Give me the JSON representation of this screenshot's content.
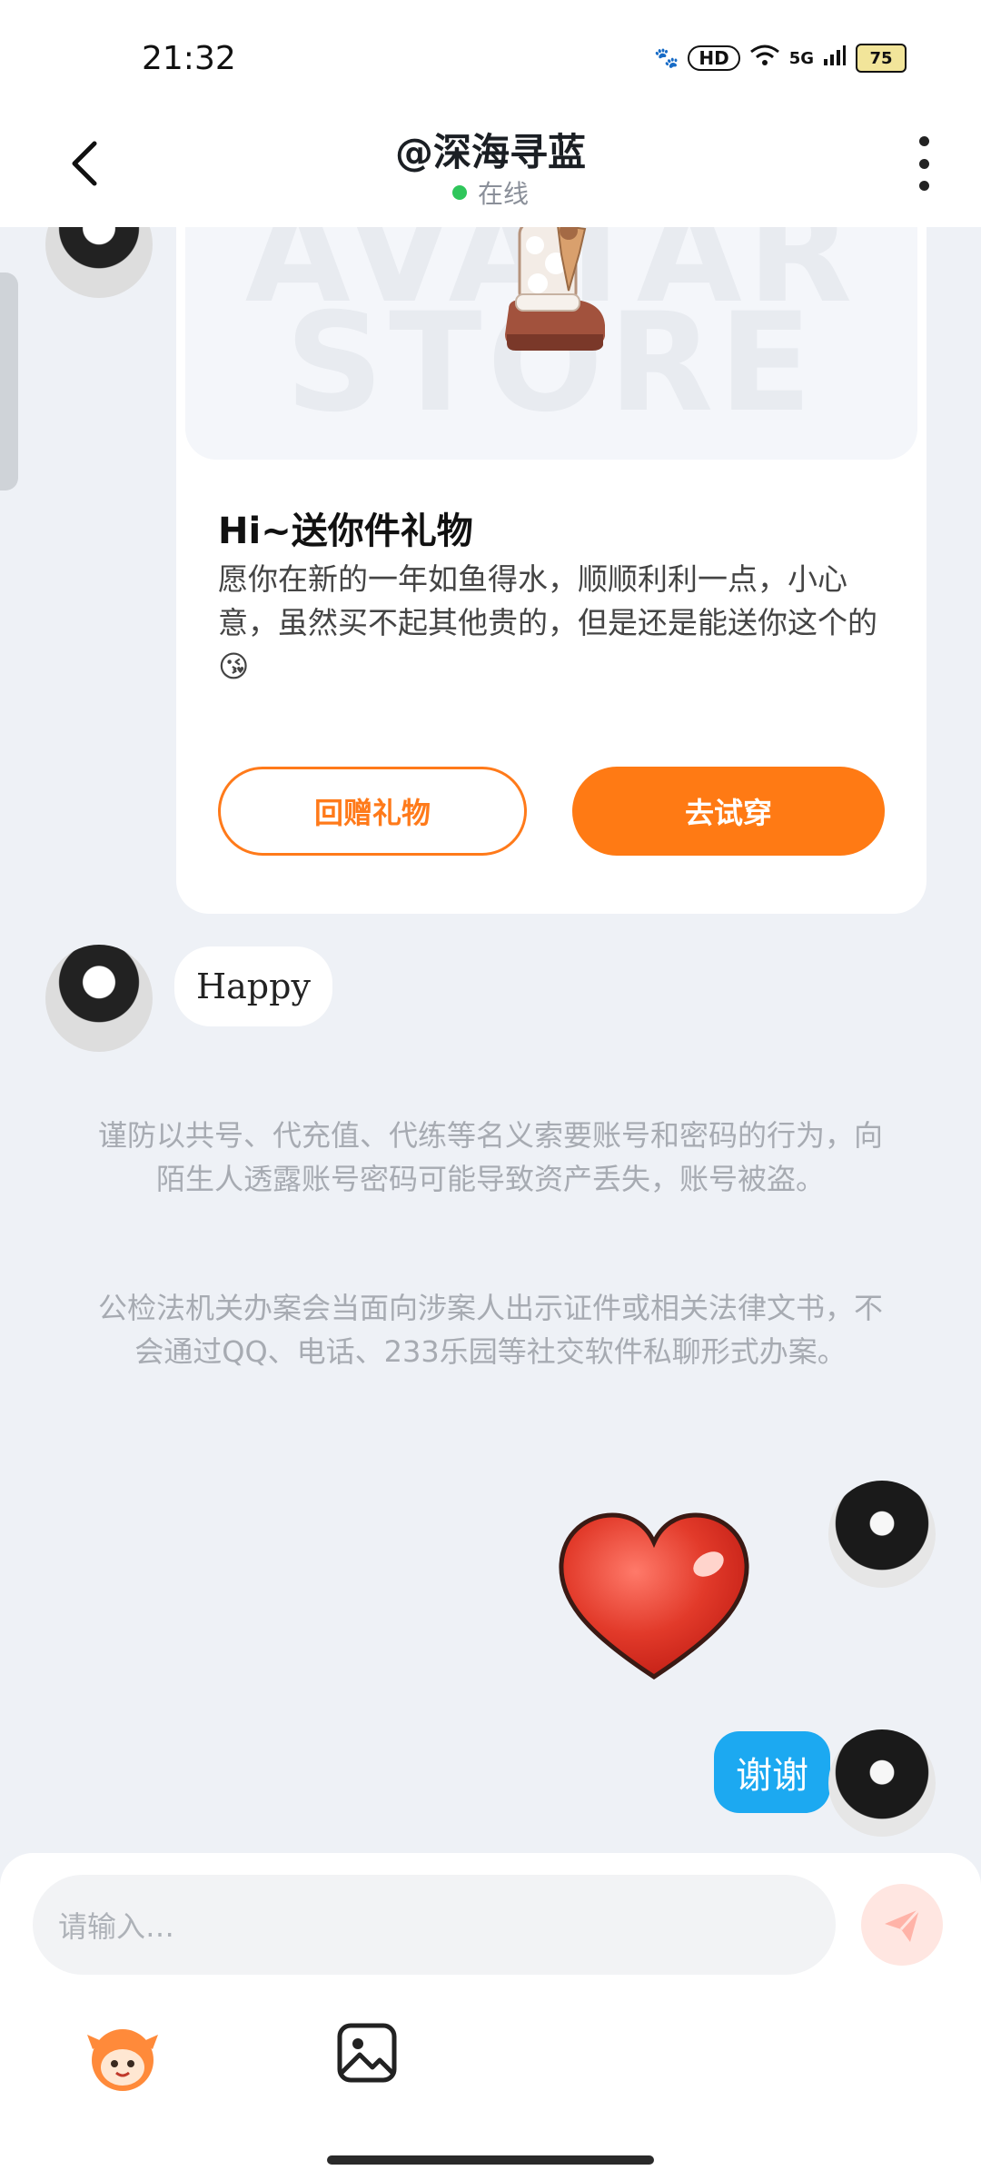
{
  "status_bar": {
    "time": "21:32",
    "network": "5G",
    "hd": "HD",
    "battery": "75"
  },
  "header": {
    "title": "@深海寻蓝",
    "online_status": "在线"
  },
  "gift_card": {
    "watermark": "AVATAR STORE",
    "title": "Hi~送你件礼物",
    "message": "愿你在新的一年如鱼得水，顺顺利利一点，小心意，虽然买不起其他贵的，但是还是能送你这个的",
    "message_emoji": "😘",
    "return_gift_label": "回赠礼物",
    "try_on_label": "去试穿"
  },
  "messages": {
    "received_text": "Happy",
    "sent_text": "谢谢"
  },
  "safety_notice": {
    "paragraph1": "谨防以共号、代充值、代练等名义索要账号和密码的行为，向陌生人透露账号密码可能导致资产丢失，账号被盗。",
    "paragraph2": "公检法机关办案会当面向涉案人出示证件或相关法律文书，不会通过QQ、电话、233乐园等社交软件私聊形式办案。"
  },
  "input": {
    "placeholder": "请输入…"
  },
  "colors": {
    "accent_orange": "#ff7a14",
    "sent_bubble": "#1ca9f1",
    "online_dot": "#2fc65b",
    "background": "#eef1f6"
  },
  "icons": {
    "back": "chevron-left-icon",
    "more": "more-vertical-icon",
    "send": "send-icon",
    "emoji": "emoji-mascot-icon",
    "image": "image-icon"
  }
}
